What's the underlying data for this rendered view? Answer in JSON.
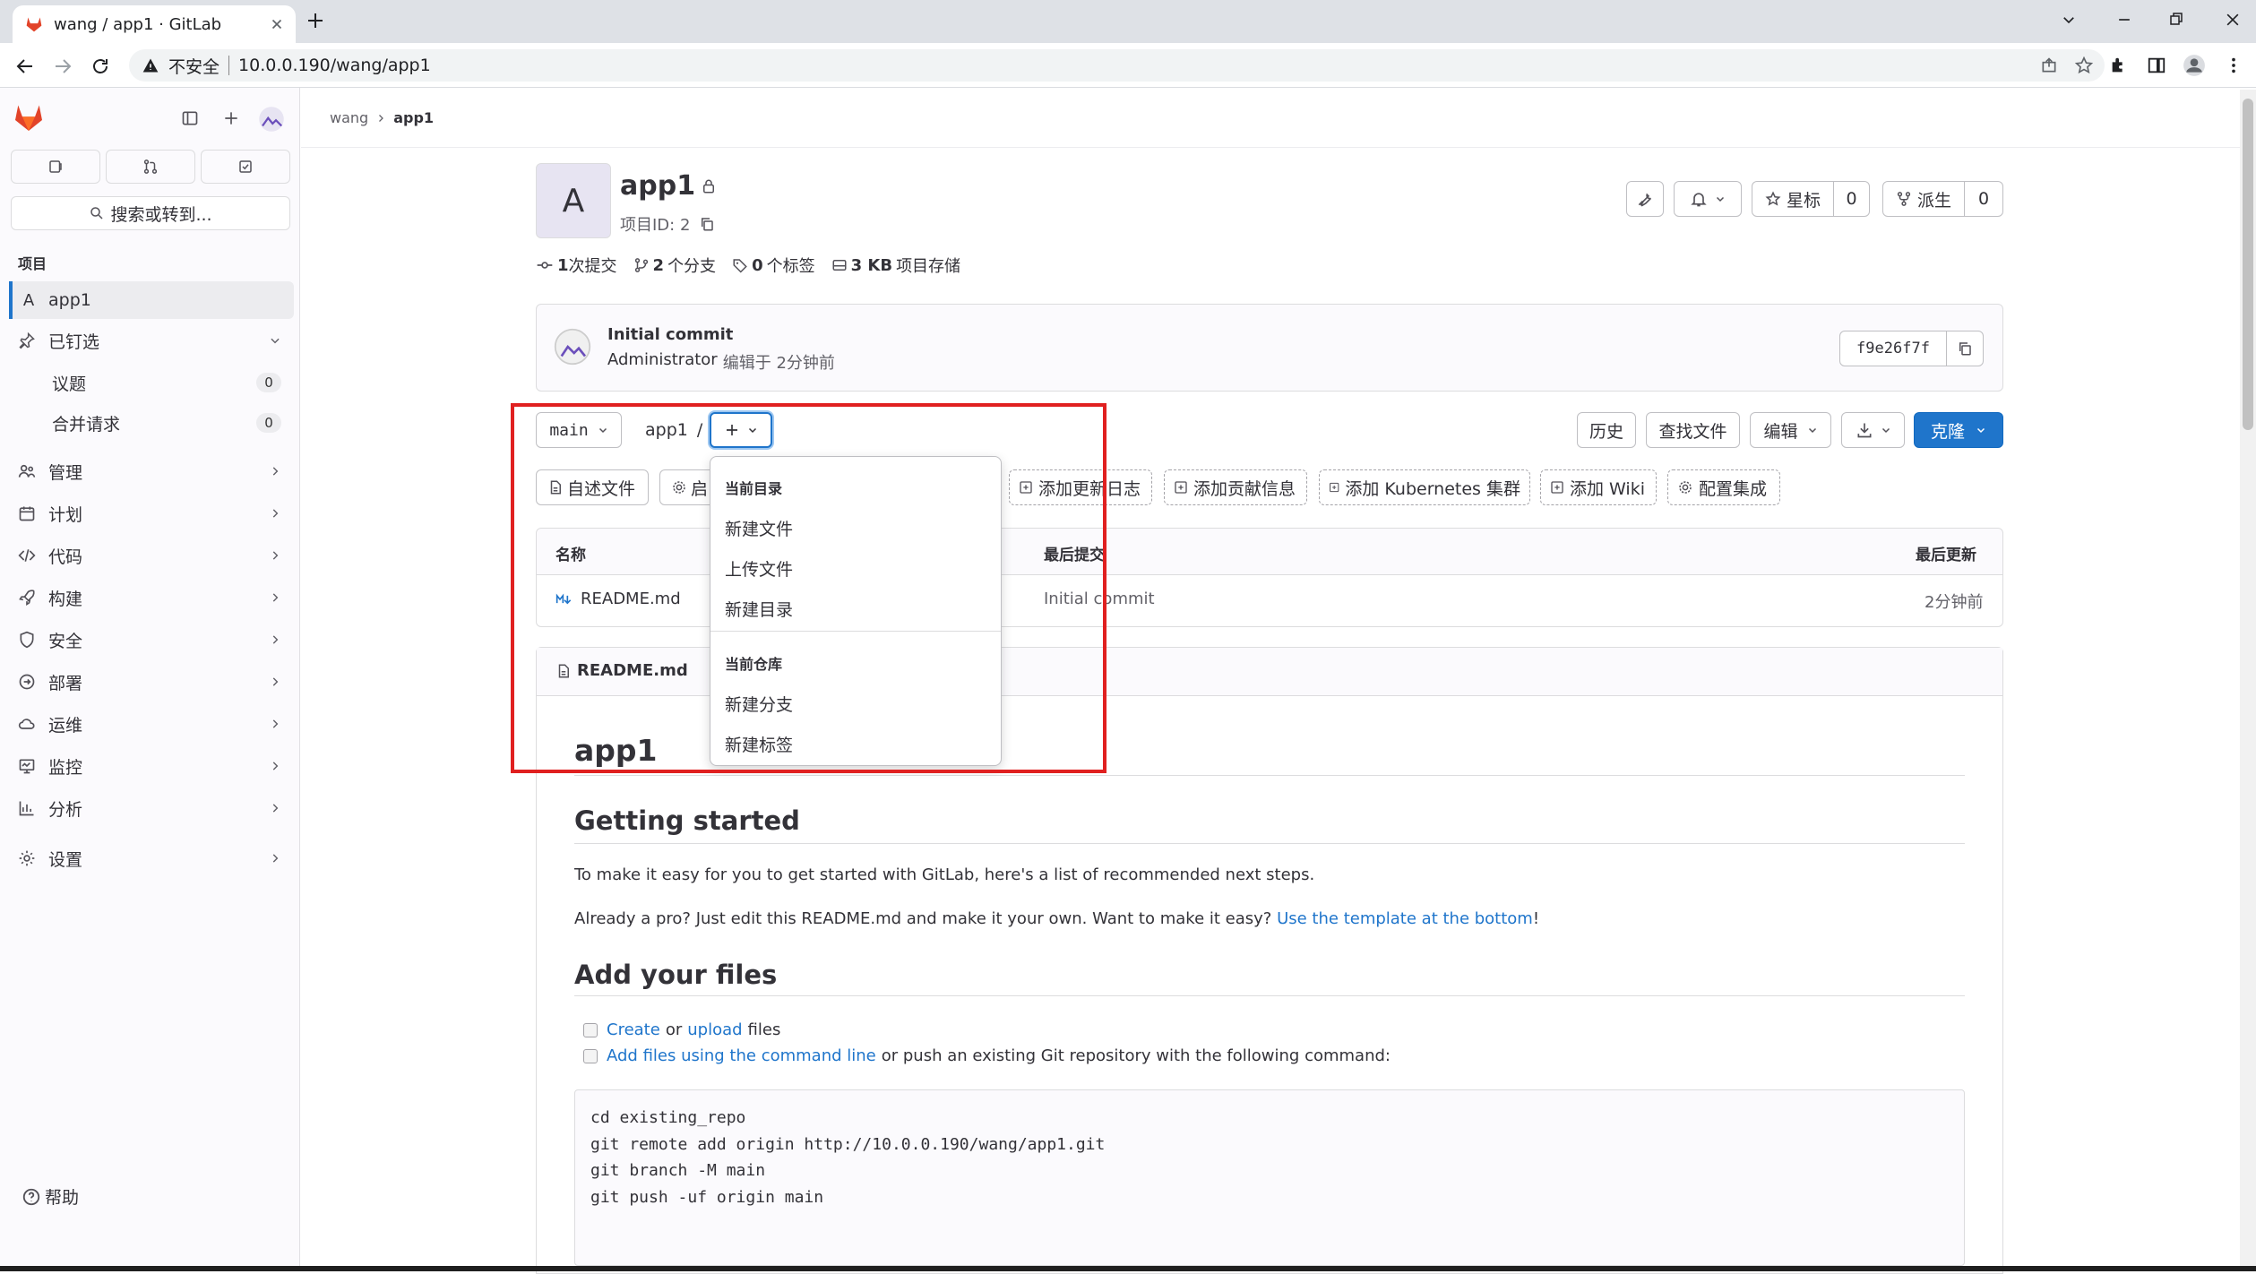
{
  "browser": {
    "tab_title": "wang / app1 · GitLab",
    "insecure_label": "不安全",
    "url": "10.0.0.190/wang/app1"
  },
  "sidebar": {
    "search_label": "搜索或转到...",
    "section_label": "项目",
    "project_initial": "A",
    "project_name": "app1",
    "pinned_label": "已钉选",
    "pinned_items": [
      {
        "label": "议题",
        "count": "0"
      },
      {
        "label": "合并请求",
        "count": "0"
      }
    ],
    "items": [
      {
        "label": "管理"
      },
      {
        "label": "计划"
      },
      {
        "label": "代码"
      },
      {
        "label": "构建"
      },
      {
        "label": "安全"
      },
      {
        "label": "部署"
      },
      {
        "label": "运维"
      },
      {
        "label": "监控"
      },
      {
        "label": "分析"
      },
      {
        "label": "设置"
      }
    ],
    "help_label": "帮助"
  },
  "breadcrumb": {
    "parent": "wang",
    "current": "app1"
  },
  "project": {
    "avatar_letter": "A",
    "name": "app1",
    "id_label": "项目ID: 2",
    "star_label": "星标",
    "star_count": "0",
    "fork_label": "派生",
    "fork_count": "0",
    "stats": [
      {
        "value": "1",
        "label": "次提交"
      },
      {
        "value": "2",
        "label": "个分支"
      },
      {
        "value": "0",
        "label": "个标签"
      },
      {
        "value": "3 KB",
        "label": "项目存储"
      }
    ]
  },
  "commit": {
    "title": "Initial commit",
    "author": "Administrator",
    "meta": "编辑于 2分钟前",
    "sha": "f9e26f7f"
  },
  "repo_toolbar": {
    "branch": "main",
    "path": "app1",
    "path_sep": "/",
    "history": "历史",
    "find_file": "查找文件",
    "edit": "编辑",
    "clone": "克隆"
  },
  "shortcuts": [
    "自述文件",
    "启",
    "添加更新日志",
    "添加贡献信息",
    "添加 Kubernetes 集群",
    "添加 Wiki",
    "配置集成"
  ],
  "dropdown": {
    "section1": "当前目录",
    "items1": [
      "新建文件",
      "上传文件",
      "新建目录"
    ],
    "section2": "当前仓库",
    "items2": [
      "新建分支",
      "新建标签"
    ]
  },
  "file_table": {
    "headers": {
      "name": "名称",
      "last_commit": "最后提交",
      "last_update": "最后更新"
    },
    "rows": [
      {
        "name": "README.md",
        "commit": "Initial commit",
        "time": "2分钟前"
      }
    ]
  },
  "readme": {
    "file_label": "README.md",
    "h1": "app1",
    "h2_start": "Getting started",
    "p1": "To make it easy for you to get started with GitLab, here's a list of recommended next steps.",
    "p2_pre": "Already a pro? Just edit this README.md and make it your own. Want to make it easy?",
    "p2_link": "Use the template at the bottom",
    "p2_post": "!",
    "h2_files": "Add your files",
    "task1_link1": "Create",
    "task1_mid": "or",
    "task1_link2": "upload",
    "task1_post": "files",
    "task2_link": "Add files using the command line",
    "task2_post": "or push an existing Git repository with the following command:",
    "code": [
      "cd existing_repo",
      "git remote add origin http://10.0.0.190/wang/app1.git",
      "git branch -M main",
      "git push -uf origin main"
    ]
  },
  "colors": {
    "accent": "#1f75cb",
    "highlight": "#e02020"
  }
}
